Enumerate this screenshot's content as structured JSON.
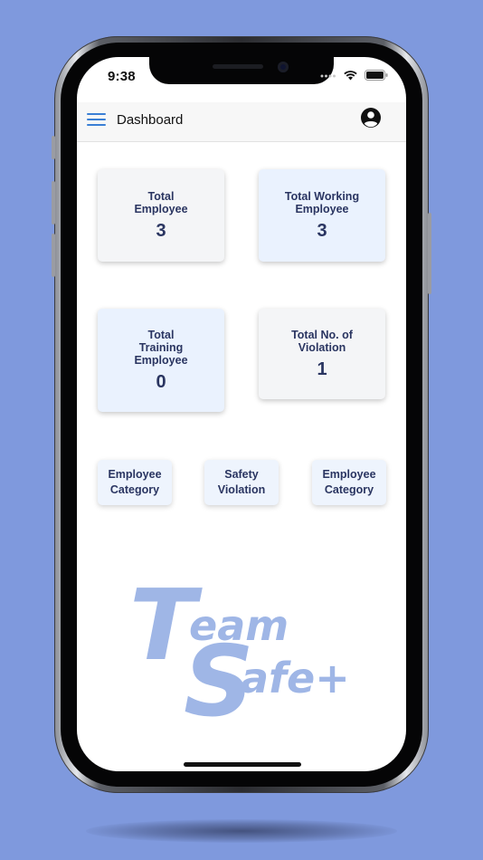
{
  "status_bar": {
    "time": "9:38"
  },
  "header": {
    "title": "Dashboard",
    "menu_icon": "hamburger-icon",
    "account_icon": "account-circle-icon"
  },
  "cards": [
    {
      "label": "Total\nEmployee",
      "value": "3"
    },
    {
      "label": "Total Working\nEmployee",
      "value": "3"
    },
    {
      "label": "Total\nTraining\nEmployee",
      "value": "0"
    },
    {
      "label": "Total No. of\nViolation",
      "value": "1"
    }
  ],
  "quick_links": [
    {
      "label": "Employee\nCategory"
    },
    {
      "label": "Safety\nViolation"
    },
    {
      "label": "Employee\nCategory"
    }
  ],
  "logo": {
    "line1_big": "T",
    "line1_rest": "eam",
    "line2_big": "S",
    "line2_rest": "afe+"
  },
  "colors": {
    "background": "#7f99dd",
    "accent": "#3a7fd5",
    "card_text": "#2a3561",
    "logo": "#9fb6e6"
  }
}
